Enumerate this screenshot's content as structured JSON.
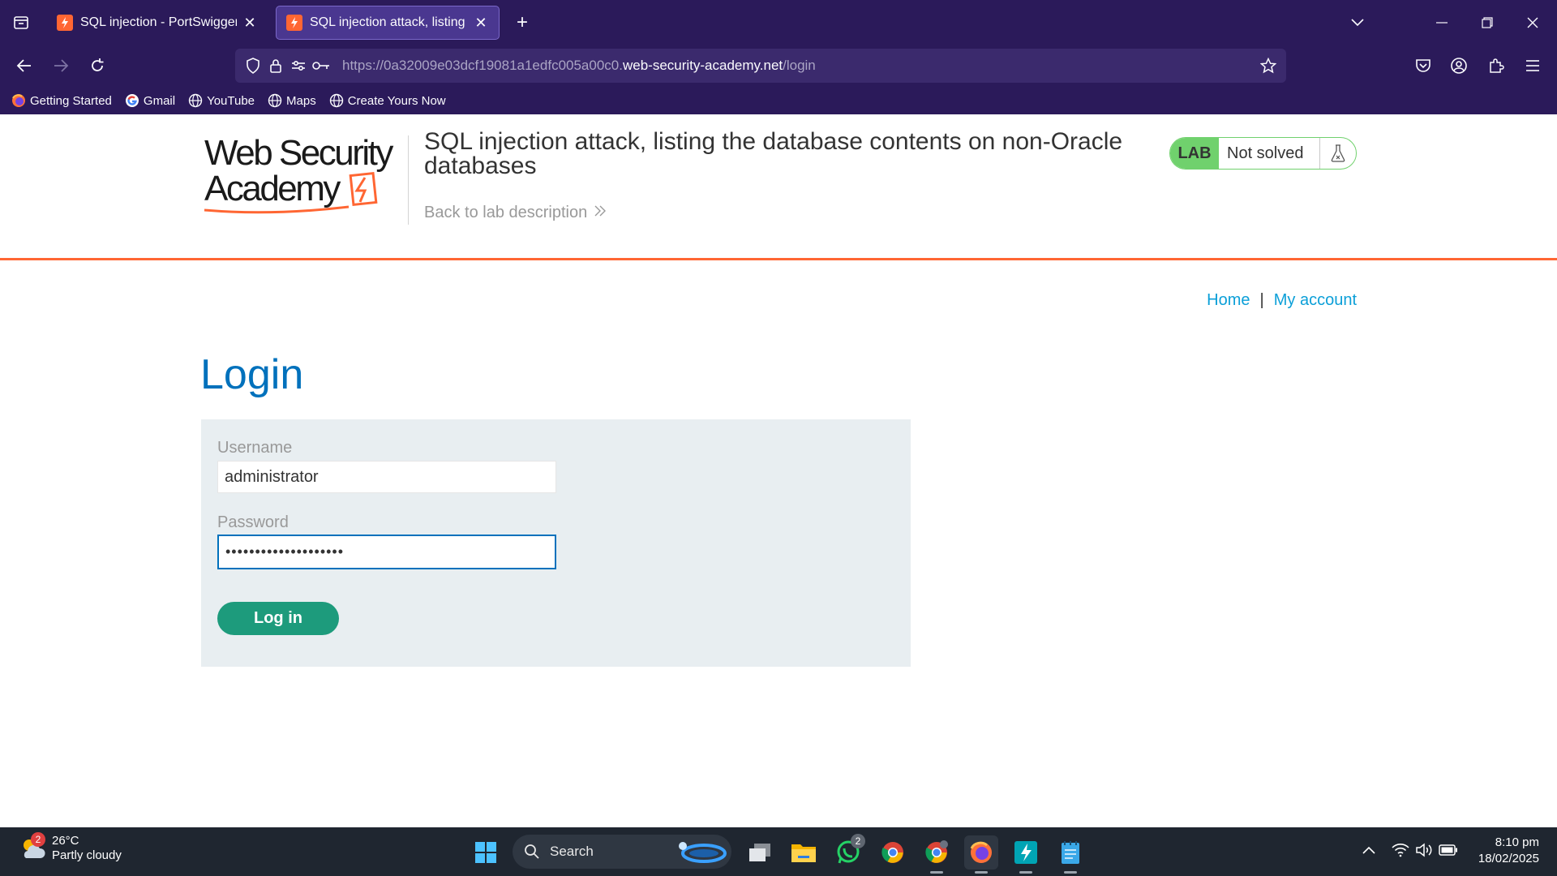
{
  "browser": {
    "tabs": [
      {
        "title": "SQL injection - PortSwigger",
        "active": false
      },
      {
        "title": "SQL injection attack, listing the",
        "active": true
      }
    ],
    "url": {
      "prefix": "https://0a32009e03dcf19081a1edfc005a00c0.",
      "host": "web-security-academy.net",
      "path": "/login"
    },
    "bookmarks": [
      {
        "label": "Getting Started",
        "icon": "firefox-icon"
      },
      {
        "label": "Gmail",
        "icon": "google-icon"
      },
      {
        "label": "YouTube",
        "icon": "globe-icon"
      },
      {
        "label": "Maps",
        "icon": "globe-icon"
      },
      {
        "label": "Create Yours Now",
        "icon": "globe-icon"
      }
    ],
    "colors": {
      "chrome": "#2b1a5a",
      "active_tab": "#4a3790"
    }
  },
  "lab": {
    "logo_line1": "Web Security",
    "logo_line2": "Academy",
    "title": "SQL injection attack, listing the database contents on non-Oracle databases",
    "back_link": "Back to lab description",
    "badge": "LAB",
    "status": "Not solved",
    "colors": {
      "accent": "#ff6633",
      "badge_green": "#70d16d"
    }
  },
  "nav": {
    "home": "Home",
    "separator": "|",
    "my_account": "My account"
  },
  "login": {
    "heading": "Login",
    "username_label": "Username",
    "username_value": "administrator",
    "password_label": "Password",
    "password_value": "••••••••••••••••••••",
    "button": "Log in",
    "colors": {
      "heading": "#0071bc",
      "button": "#1d9b7c"
    }
  },
  "taskbar": {
    "weather_temp": "26°C",
    "weather_cond": "Partly cloudy",
    "weather_badge": "2",
    "search_label": "Search",
    "whatsapp_badge": "2",
    "time": "8:10 pm",
    "date": "18/02/2025"
  }
}
